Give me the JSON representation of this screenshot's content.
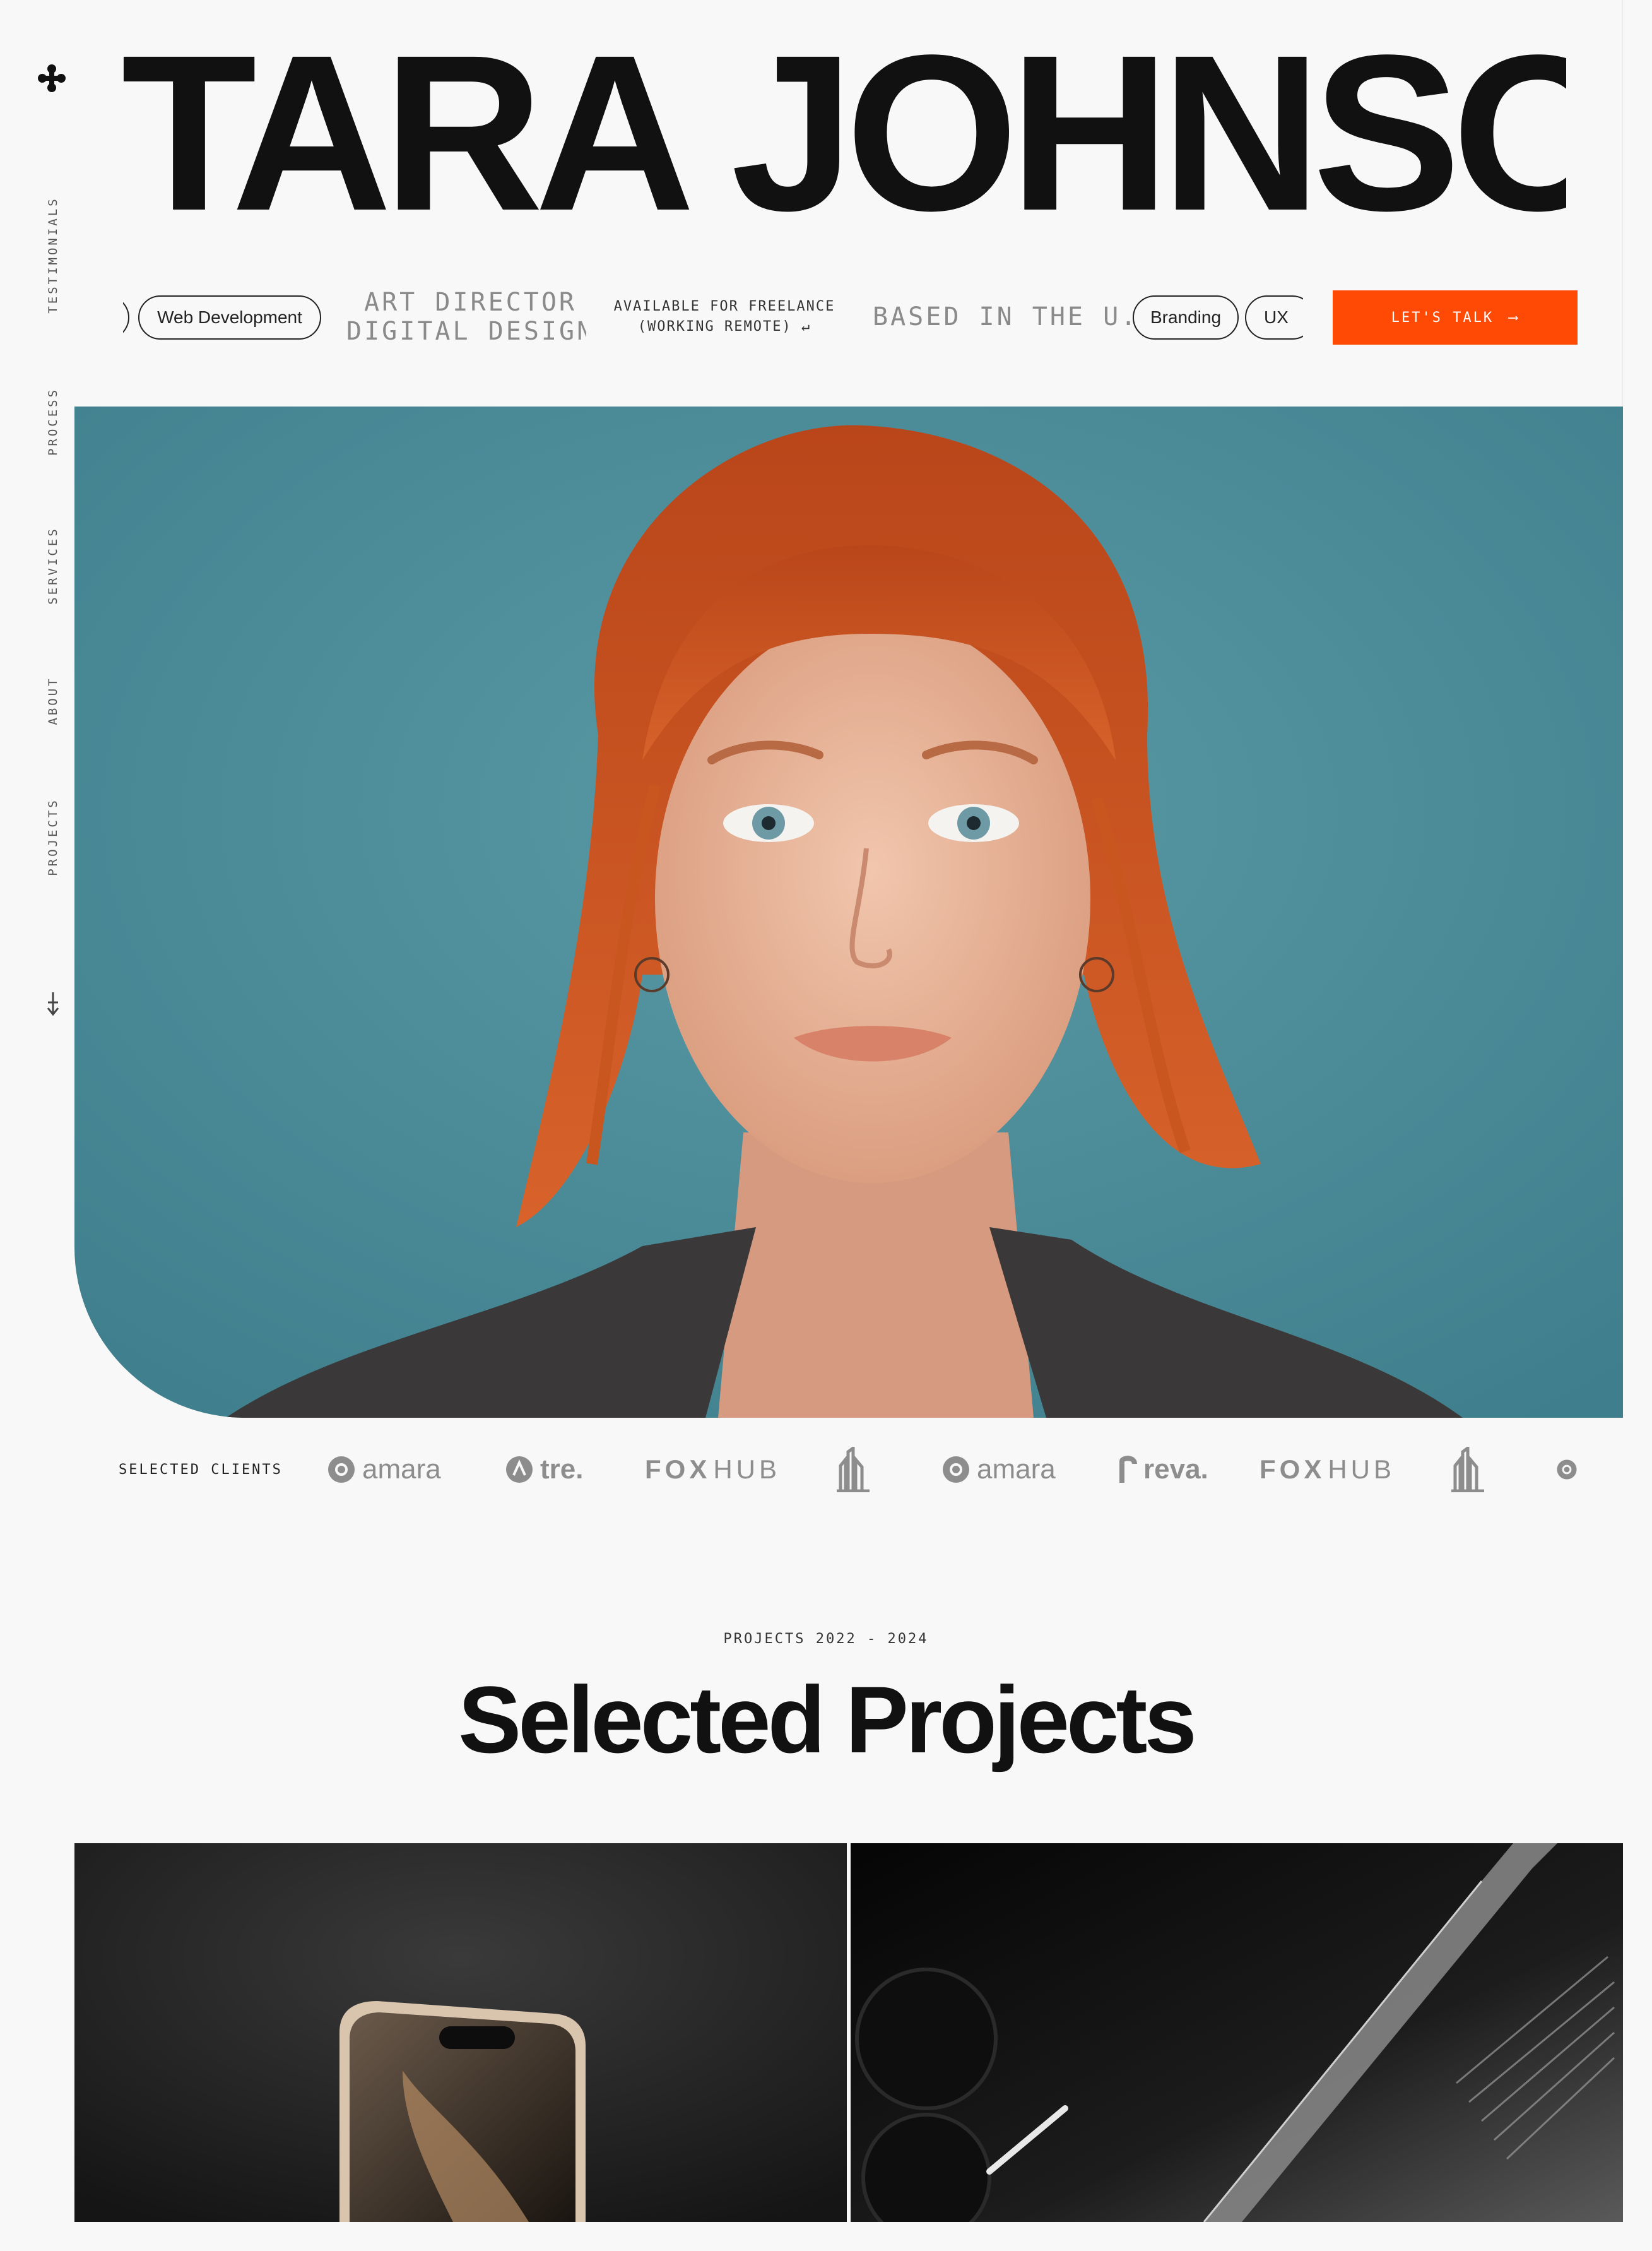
{
  "brand": {
    "logo_icon": "four-dot-cross-icon"
  },
  "side_nav": {
    "items": [
      {
        "label": "TESTIMONIALS"
      },
      {
        "label": "PROCESS"
      },
      {
        "label": "SERVICES"
      },
      {
        "label": "ABOUT"
      },
      {
        "label": "PROJECTS"
      }
    ],
    "scroll_icon": "arrow-down-icon"
  },
  "hero": {
    "name": "TARA JOHNSON"
  },
  "ticker": {
    "pill_web": "Web Development",
    "role_line1": "ART DIRECTOR",
    "role_line2": "DIGITAL DESIGN",
    "availability_line1": "AVAILABLE FOR FREELANCE",
    "availability_line2": "(WORKING REMOTE) ↵",
    "location": "BASED IN THE U.",
    "pill_branding": "Branding",
    "pill_ux": "UX"
  },
  "cta": {
    "label": "LET'S TALK",
    "arrow": "⟶",
    "color": "#ff4a05"
  },
  "portrait": {
    "background": "#4f8d99",
    "hair": "#c9551f"
  },
  "clients": {
    "label": "SELECTED CLIENTS",
    "logos": [
      {
        "name": "amara",
        "icon": "at-circle-icon"
      },
      {
        "name": "tre.",
        "icon": "leaf-circle-icon"
      },
      {
        "name": "FOX",
        "suffix": "HUB"
      },
      {
        "name": "",
        "icon": "tower-icon"
      },
      {
        "name": "amara",
        "icon": "at-circle-icon"
      },
      {
        "name": "reva.",
        "icon": "r-glyph-icon"
      },
      {
        "name": "FOX",
        "suffix": "HUB"
      },
      {
        "name": "",
        "icon": "tower-icon"
      }
    ]
  },
  "projects": {
    "kicker": "PROJECTS 2022 - 2024",
    "title": "Selected Projects"
  }
}
